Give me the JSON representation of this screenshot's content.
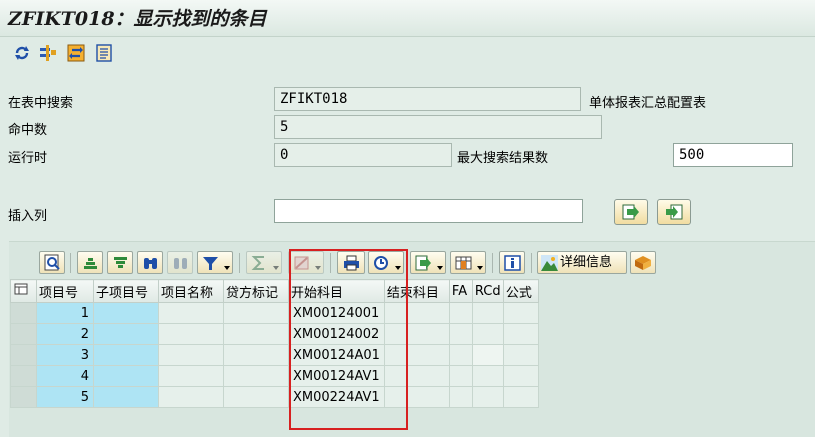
{
  "title": "ZFIKT018：显示找到的条目",
  "toolbar_icons": [
    "refresh-icon",
    "filter-icon",
    "change-icon",
    "list-icon"
  ],
  "form": {
    "search_table_label": "在表中搜索",
    "search_table_value": "ZFIKT018",
    "search_table_desc": "单体报表汇总配置表",
    "hits_label": "命中数",
    "hits_value": "5",
    "runtime_label": "运行时",
    "runtime_value": "0",
    "max_results_label": "最大搜索结果数",
    "max_results_value": "500",
    "insert_col_label": "插入列",
    "insert_col_value": ""
  },
  "alv_toolbar": {
    "detail_label": "详细信息"
  },
  "table": {
    "columns": [
      "项目号",
      "子项目号",
      "项目名称",
      "贷方标记",
      "开始科目",
      "结束科目",
      "FA",
      "RCd",
      "公式"
    ],
    "rows": [
      {
        "item": "1",
        "sub": "",
        "name": "",
        "credit": "",
        "start": "XM00124001",
        "end": "",
        "fa": "",
        "rcd": "",
        "formula": ""
      },
      {
        "item": "2",
        "sub": "",
        "name": "",
        "credit": "",
        "start": "XM00124002",
        "end": "",
        "fa": "",
        "rcd": "",
        "formula": ""
      },
      {
        "item": "3",
        "sub": "",
        "name": "",
        "credit": "",
        "start": "XM00124A01",
        "end": "",
        "fa": "",
        "rcd": "",
        "formula": ""
      },
      {
        "item": "4",
        "sub": "",
        "name": "",
        "credit": "",
        "start": "XM00124AV1",
        "end": "",
        "fa": "",
        "rcd": "",
        "formula": ""
      },
      {
        "item": "5",
        "sub": "",
        "name": "",
        "credit": "",
        "start": "XM00224AV1",
        "end": "",
        "fa": "",
        "rcd": "",
        "formula": ""
      }
    ]
  },
  "colors": {
    "background": "#dfebe5",
    "highlight_cell": "#aee4f4",
    "annotation_box": "#d72020"
  }
}
